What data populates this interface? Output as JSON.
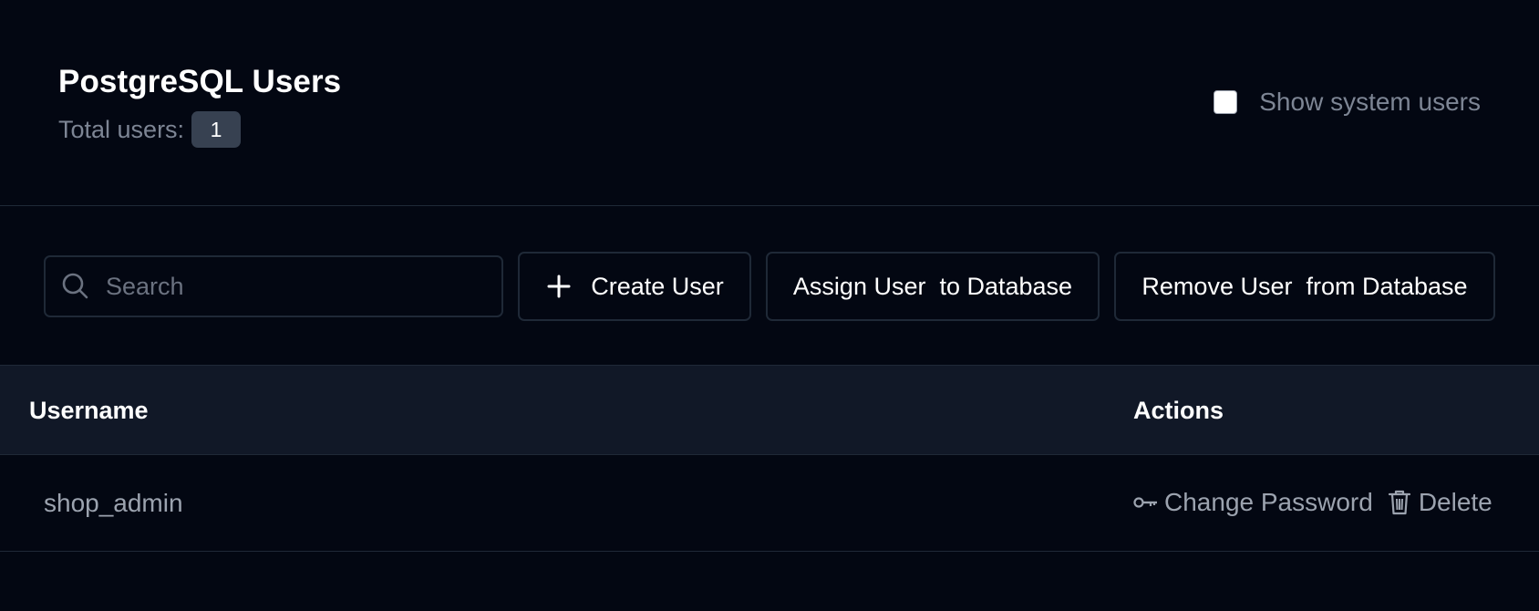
{
  "header": {
    "title": "PostgreSQL Users",
    "total_label": "Total users:",
    "total_count": "1",
    "show_system_label": "Show system users",
    "show_system_checked": false
  },
  "toolbar": {
    "search_placeholder": "Search",
    "search_value": "",
    "create_label": "Create User",
    "assign_label": "Assign User  to Database",
    "remove_label": "Remove User  from Database"
  },
  "table": {
    "columns": [
      "Username",
      "Actions"
    ],
    "rows": [
      {
        "username": "shop_admin",
        "change_password_label": "Change Password",
        "delete_label": "Delete"
      }
    ]
  },
  "icons": {
    "search": "search-icon",
    "plus": "plus-icon",
    "key": "key-icon",
    "trash": "trash-icon"
  },
  "colors": {
    "background": "#030712",
    "table_header_bg": "#111827",
    "border": "#1f2937",
    "muted_text": "#9ca3af",
    "badge_bg": "#374151"
  }
}
